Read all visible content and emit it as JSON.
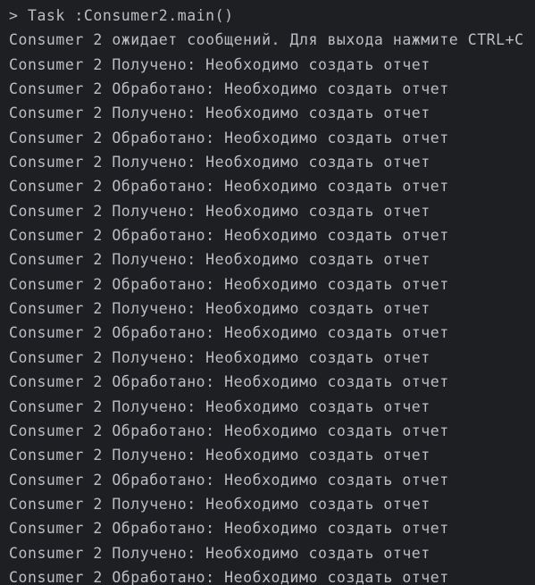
{
  "console": {
    "background_color": "#1d1f23",
    "text_color": "#bcbec4",
    "lines": [
      {
        "text": "> Task :Consumer2.main()",
        "kind": "task"
      },
      {
        "text": "Consumer 2 ожидает сообщений. Для выхода нажмите CTRL+C",
        "kind": "output"
      },
      {
        "text": "Consumer 2 Получено: Необходимо создать отчет",
        "kind": "output"
      },
      {
        "text": "Consumer 2 Обработано: Необходимо создать отчет",
        "kind": "output"
      },
      {
        "text": "Consumer 2 Получено: Необходимо создать отчет",
        "kind": "output"
      },
      {
        "text": "Consumer 2 Обработано: Необходимо создать отчет",
        "kind": "output"
      },
      {
        "text": "Consumer 2 Получено: Необходимо создать отчет",
        "kind": "output"
      },
      {
        "text": "Consumer 2 Обработано: Необходимо создать отчет",
        "kind": "output"
      },
      {
        "text": "Consumer 2 Получено: Необходимо создать отчет",
        "kind": "output"
      },
      {
        "text": "Consumer 2 Обработано: Необходимо создать отчет",
        "kind": "output"
      },
      {
        "text": "Consumer 2 Получено: Необходимо создать отчет",
        "kind": "output"
      },
      {
        "text": "Consumer 2 Обработано: Необходимо создать отчет",
        "kind": "output"
      },
      {
        "text": "Consumer 2 Получено: Необходимо создать отчет",
        "kind": "output"
      },
      {
        "text": "Consumer 2 Обработано: Необходимо создать отчет",
        "kind": "output"
      },
      {
        "text": "Consumer 2 Получено: Необходимо создать отчет",
        "kind": "output"
      },
      {
        "text": "Consumer 2 Обработано: Необходимо создать отчет",
        "kind": "output"
      },
      {
        "text": "Consumer 2 Получено: Необходимо создать отчет",
        "kind": "output"
      },
      {
        "text": "Consumer 2 Обработано: Необходимо создать отчет",
        "kind": "output"
      },
      {
        "text": "Consumer 2 Получено: Необходимо создать отчет",
        "kind": "output"
      },
      {
        "text": "Consumer 2 Обработано: Необходимо создать отчет",
        "kind": "output"
      },
      {
        "text": "Consumer 2 Получено: Необходимо создать отчет",
        "kind": "output"
      },
      {
        "text": "Consumer 2 Обработано: Необходимо создать отчет",
        "kind": "output"
      },
      {
        "text": "Consumer 2 Получено: Необходимо создать отчет",
        "kind": "output"
      },
      {
        "text": "Consumer 2 Обработано: Необходимо создать отчет",
        "kind": "output"
      }
    ]
  }
}
